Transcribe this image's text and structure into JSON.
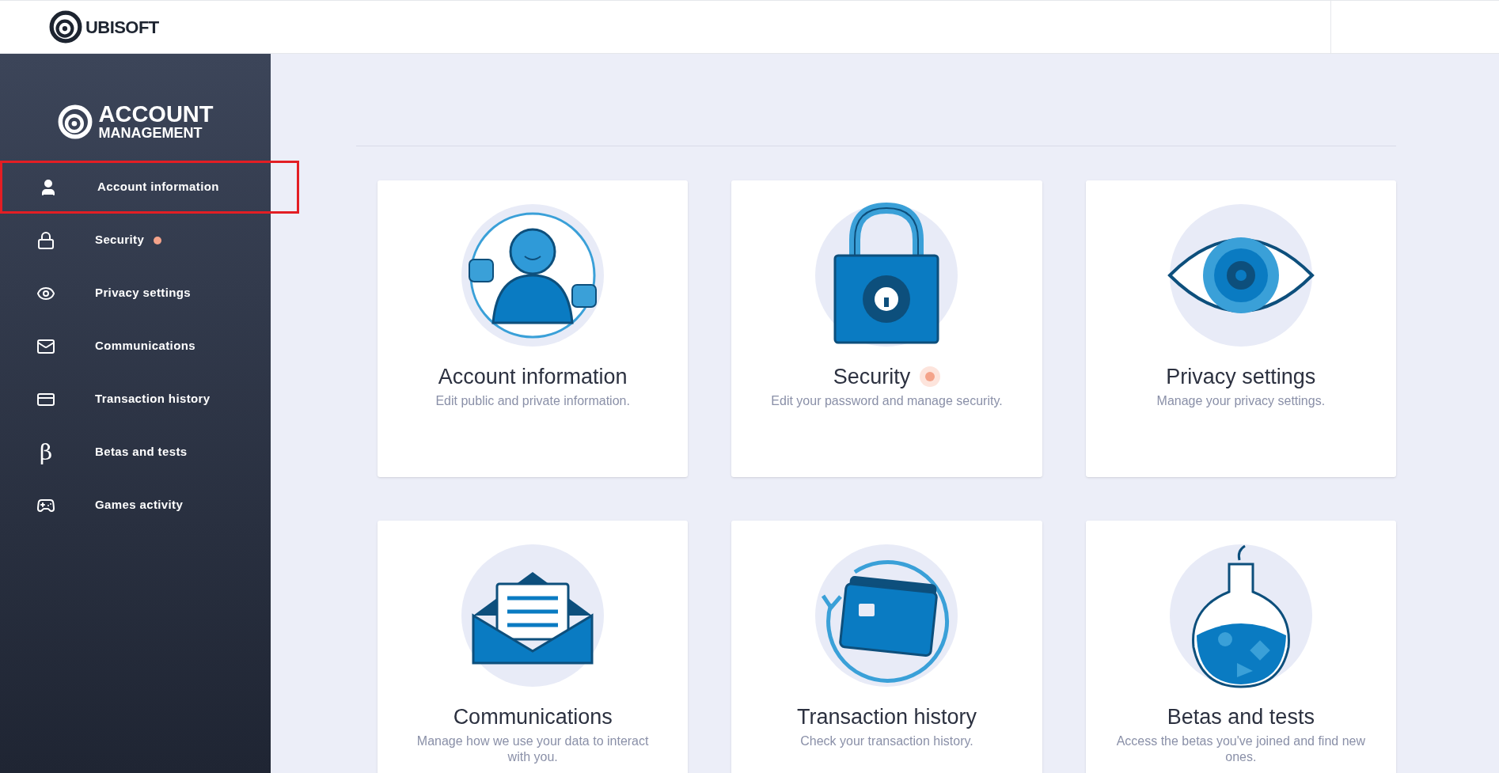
{
  "header": {
    "brand": "UBISOFT"
  },
  "sidebar": {
    "logo": {
      "title": "ACCOUNT",
      "subtitle": "MANAGEMENT"
    },
    "items": [
      {
        "kind": "account",
        "label": "Account information",
        "highlighted": true,
        "badge": false
      },
      {
        "kind": "security",
        "label": "Security",
        "highlighted": false,
        "badge": true
      },
      {
        "kind": "privacy",
        "label": "Privacy settings",
        "highlighted": false,
        "badge": false
      },
      {
        "kind": "communications",
        "label": "Communications",
        "highlighted": false,
        "badge": false
      },
      {
        "kind": "transactions",
        "label": "Transaction history",
        "highlighted": false,
        "badge": false
      },
      {
        "kind": "betas",
        "label": "Betas and tests",
        "highlighted": false,
        "badge": false,
        "glyph": "β"
      },
      {
        "kind": "games",
        "label": "Games activity",
        "highlighted": false,
        "badge": false
      }
    ]
  },
  "cards": [
    {
      "kind": "account",
      "title": "Account information",
      "description": "Edit public and private information.",
      "badge": false
    },
    {
      "kind": "security",
      "title": "Security",
      "description": "Edit your password and manage security.",
      "badge": true
    },
    {
      "kind": "privacy",
      "title": "Privacy settings",
      "description": "Manage your privacy settings.",
      "badge": false
    },
    {
      "kind": "communications",
      "title": "Communications",
      "description": "Manage how we use your data to interact with you.",
      "badge": false
    },
    {
      "kind": "transactions",
      "title": "Transaction history",
      "description": "Check your transaction history.",
      "badge": false
    },
    {
      "kind": "betas",
      "title": "Betas and tests",
      "description": "Access the betas you've joined and find new ones.",
      "badge": false
    }
  ]
}
